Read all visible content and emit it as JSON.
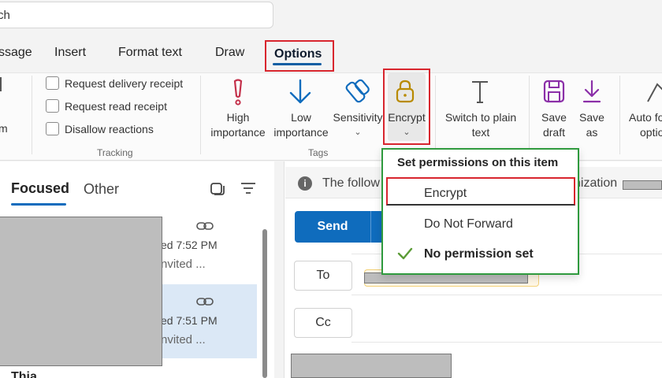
{
  "search": {
    "value": "ch"
  },
  "ribbon_tabs": [
    {
      "label": "ssage"
    },
    {
      "label": "Insert"
    },
    {
      "label": "Format text"
    },
    {
      "label": "Draw"
    },
    {
      "label": "Options",
      "selected": true
    }
  ],
  "ribbon": {
    "left_fragments": [
      "m"
    ],
    "tracking": {
      "checkboxes": [
        "Request delivery receipt",
        "Request read receipt",
        "Disallow reactions"
      ],
      "group_label": "Tracking"
    },
    "tags": {
      "buttons": [
        {
          "label_line1": "High",
          "label_line2": "importance",
          "icon": "exclamation-icon"
        },
        {
          "label_line1": "Low",
          "label_line2": "importance",
          "icon": "down-arrow-icon"
        },
        {
          "label_line1": "Sensitivity",
          "icon": "tag-icon"
        },
        {
          "label_line1": "Encrypt",
          "icon": "lock-icon"
        }
      ],
      "group_label": "Tags"
    },
    "switch_plain": {
      "label_line1": "Switch to plain",
      "label_line2": "text"
    },
    "save_draft": {
      "label_line1": "Save",
      "label_line2": "draft"
    },
    "save_as": {
      "label_line1": "Save",
      "label_line2": "as"
    },
    "auto_fragment": {
      "label_line1": "Auto fo",
      "label_line2": "optio"
    }
  },
  "mail_list": {
    "tabs": {
      "focused": "Focused",
      "other": "Other"
    },
    "items": [
      {
        "time": "ed 7:52 PM",
        "preview": "nvited ..."
      },
      {
        "time": "ed 7:51 PM",
        "preview": "nvited ..."
      }
    ],
    "bottom_fragment": "Thia..."
  },
  "compose": {
    "info_text_left": "The follow",
    "info_text_right": "nization",
    "send_label": "Send",
    "to_label": "To",
    "cc_label": "Cc"
  },
  "encrypt_menu": {
    "title": "Set permissions on this item",
    "items": [
      {
        "label": "Encrypt",
        "checked": false
      },
      {
        "label": "Do Not Forward",
        "checked": false
      },
      {
        "label": "No permission set",
        "checked": true
      }
    ]
  },
  "colors": {
    "accent": "#0f6cbd",
    "highlight_red": "#d8262e",
    "highlight_green": "#2f9a3e",
    "high_importance": "#c4314b",
    "save_purple": "#8b2fa8"
  }
}
